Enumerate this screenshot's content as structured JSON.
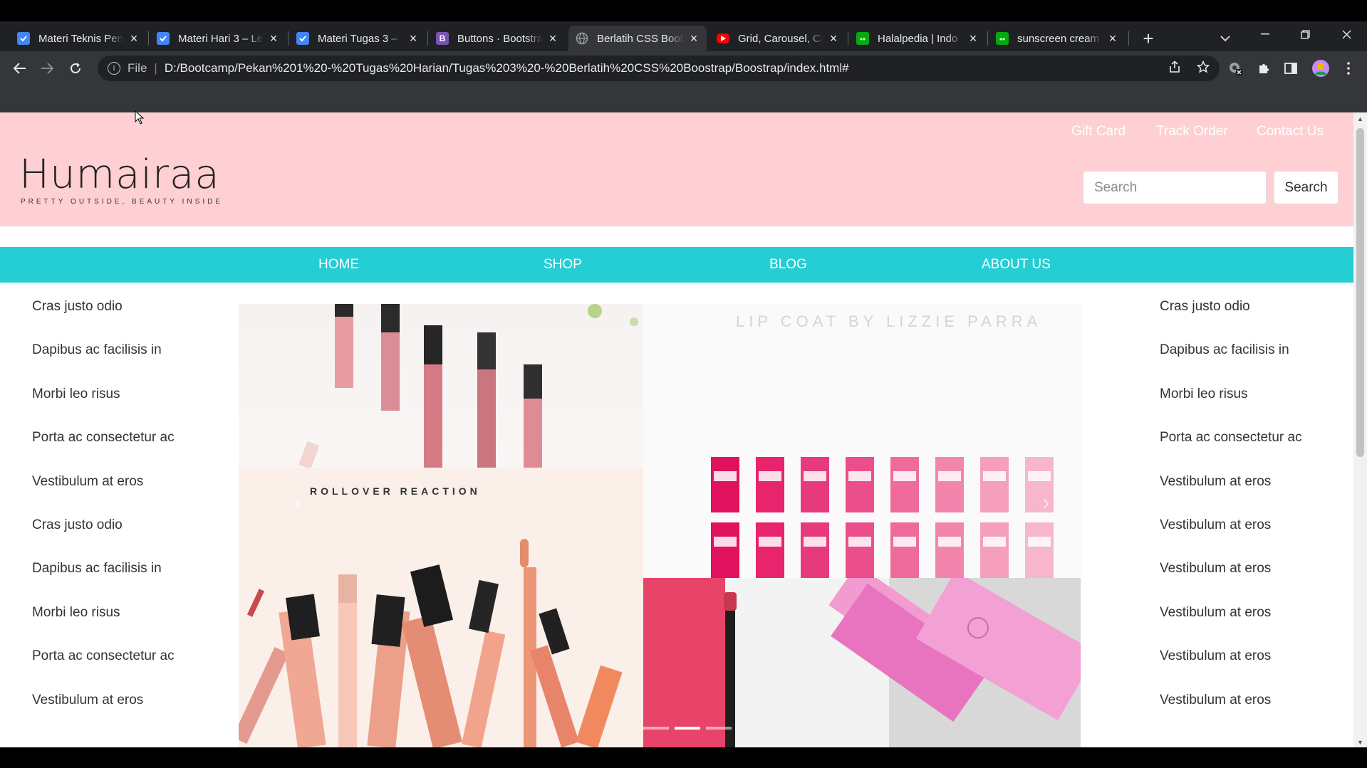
{
  "browser": {
    "tabs": [
      {
        "title": "Materi Teknis Pen",
        "icon": "doc-favicon-icon",
        "color": "#4285f4"
      },
      {
        "title": "Materi Hari 3 – Le",
        "icon": "doc-favicon-icon",
        "color": "#4285f4"
      },
      {
        "title": "Materi Tugas 3 –",
        "icon": "doc-favicon-icon",
        "color": "#4285f4"
      },
      {
        "title": "Buttons · Bootstra",
        "icon": "bootstrap-favicon-icon",
        "color": "#7952b3"
      },
      {
        "title": "Berlatih CSS Boot",
        "icon": "globe-favicon-icon",
        "color": "#9aa0a6",
        "active": true
      },
      {
        "title": "Grid, Carousel, Ca",
        "icon": "youtube-favicon-icon",
        "color": "#ff0000"
      },
      {
        "title": "Halalpedia | Indo",
        "icon": "shop-favicon-icon",
        "color": "#03ac0e"
      },
      {
        "title": "sunscreen cream",
        "icon": "shop-favicon-icon",
        "color": "#03ac0e"
      }
    ],
    "bootstrap_letter": "B",
    "new_tab": "+",
    "address": {
      "scheme": "File",
      "url": "D:/Bootcamp/Pekan%201%20-%20Tugas%20Harian/Tugas%203%20-%20Berlatih%20CSS%20Boostrap/Boostrap/index.html#"
    }
  },
  "site": {
    "logo": {
      "name": "Humairaa",
      "tagline": "PRETTY OUTSIDE, BEAUTY INSIDE"
    },
    "top_links": [
      "Gift Card",
      "Track Order",
      "Contact Us"
    ],
    "search": {
      "placeholder": "Search",
      "button": "Search"
    },
    "nav": [
      "HOME",
      "SHOP",
      "BLOG",
      "ABOUT US"
    ],
    "left_list": [
      "Cras justo odio",
      "Dapibus ac facilisis in",
      "Morbi leo risus",
      "Porta ac consectetur ac",
      "Vestibulum at eros",
      "Cras justo odio",
      "Dapibus ac facilisis in",
      "Morbi leo risus",
      "Porta ac consectetur ac",
      "Vestibulum at eros"
    ],
    "right_list": [
      "Cras justo odio",
      "Dapibus ac facilisis in",
      "Morbi leo risus",
      "Porta ac consectetur ac",
      "Vestibulum at eros",
      "Vestibulum at eros",
      "Vestibulum at eros",
      "Vestibulum at eros",
      "Vestibulum at eros",
      "Vestibulum at eros"
    ],
    "carousel": {
      "image_text_top": "LIP COAT BY LIZZIE PARRA",
      "image_text_brand": "ROLLOVER REACTION",
      "prev": "‹",
      "next": "›",
      "slide_count": 3,
      "active_slide": 2
    },
    "colors": {
      "header_bg": "#ffd0d3",
      "nav_bg": "#25cdd4",
      "carousel_side": "#7ec4f3"
    }
  }
}
